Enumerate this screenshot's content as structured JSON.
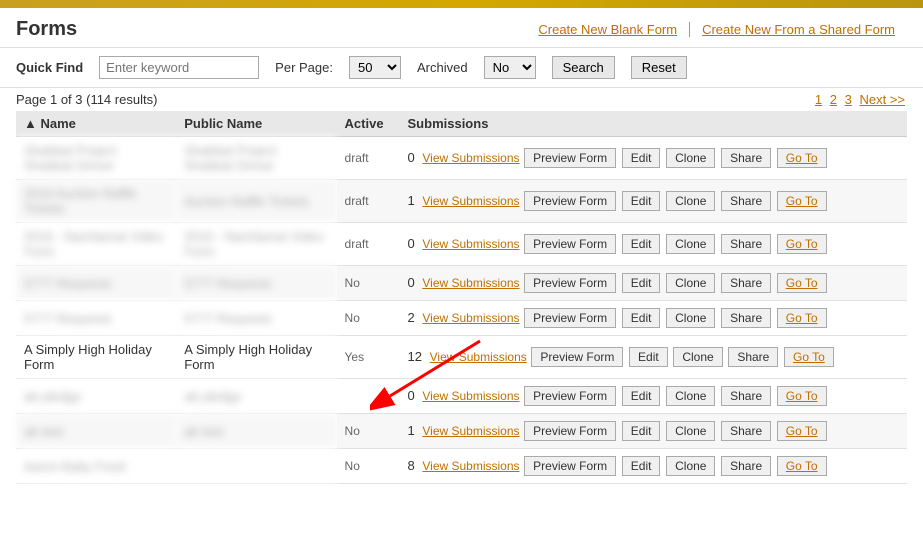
{
  "topbar": {},
  "header": {
    "title": "Forms",
    "links": [
      {
        "label": "Create New Blank Form"
      },
      {
        "label": "Create New From a Shared Form"
      }
    ]
  },
  "toolbar": {
    "quick_find_label": "Quick Find",
    "quick_find_placeholder": "Enter keyword",
    "per_page_label": "Per Page:",
    "per_page_value": "50",
    "archived_label": "Archived",
    "archived_value": "No",
    "search_label": "Search",
    "reset_label": "Reset"
  },
  "pagination": {
    "info": "Page 1 of 3 (114 results)",
    "pages": [
      "1",
      "2",
      "3",
      "Next >>"
    ]
  },
  "table": {
    "columns": [
      "Name",
      "Public Name",
      "Active",
      "Submissions"
    ],
    "rows": [
      {
        "name": "Shabbat Project Shabbat Dinner",
        "public_name": "Shabbat Project Shabbat Dinner",
        "active": "draft",
        "submissions": "0",
        "blurred": true
      },
      {
        "name": "2016 Auction Raffle Tickets",
        "public_name": "Auction Raffle Tickets",
        "active": "draft",
        "submissions": "1",
        "blurred": true
      },
      {
        "name": "2016 - Nachlamat Video Form",
        "public_name": "2016 - Nachlamat Video Form",
        "active": "draft",
        "submissions": "0",
        "blurred": true
      },
      {
        "name": "5777 Requests",
        "public_name": "5777 Requests",
        "active": "No",
        "submissions": "0",
        "blurred": true
      },
      {
        "name": "5777 Requests",
        "public_name": "5777 Requests",
        "active": "No",
        "submissions": "2",
        "blurred": true
      },
      {
        "name": "A Simply High Holiday Form",
        "public_name": "A Simply High Holiday Form",
        "active": "Yes",
        "submissions": "12",
        "blurred": false,
        "highlighted": true
      },
      {
        "name": "ab pledge",
        "public_name": "ab pledge",
        "active": "",
        "submissions": "0",
        "blurred": true
      },
      {
        "name": "ab test",
        "public_name": "ab test",
        "active": "No",
        "submissions": "1",
        "blurred": true
      },
      {
        "name": "Aaron Baby Food",
        "public_name": "",
        "active": "No",
        "submissions": "8",
        "blurred": true
      }
    ],
    "buttons": {
      "view_submissions": "View Submissions",
      "preview_form": "Preview Form",
      "edit": "Edit",
      "clone": "Clone",
      "share": "Share",
      "go_to": "Go To"
    }
  }
}
